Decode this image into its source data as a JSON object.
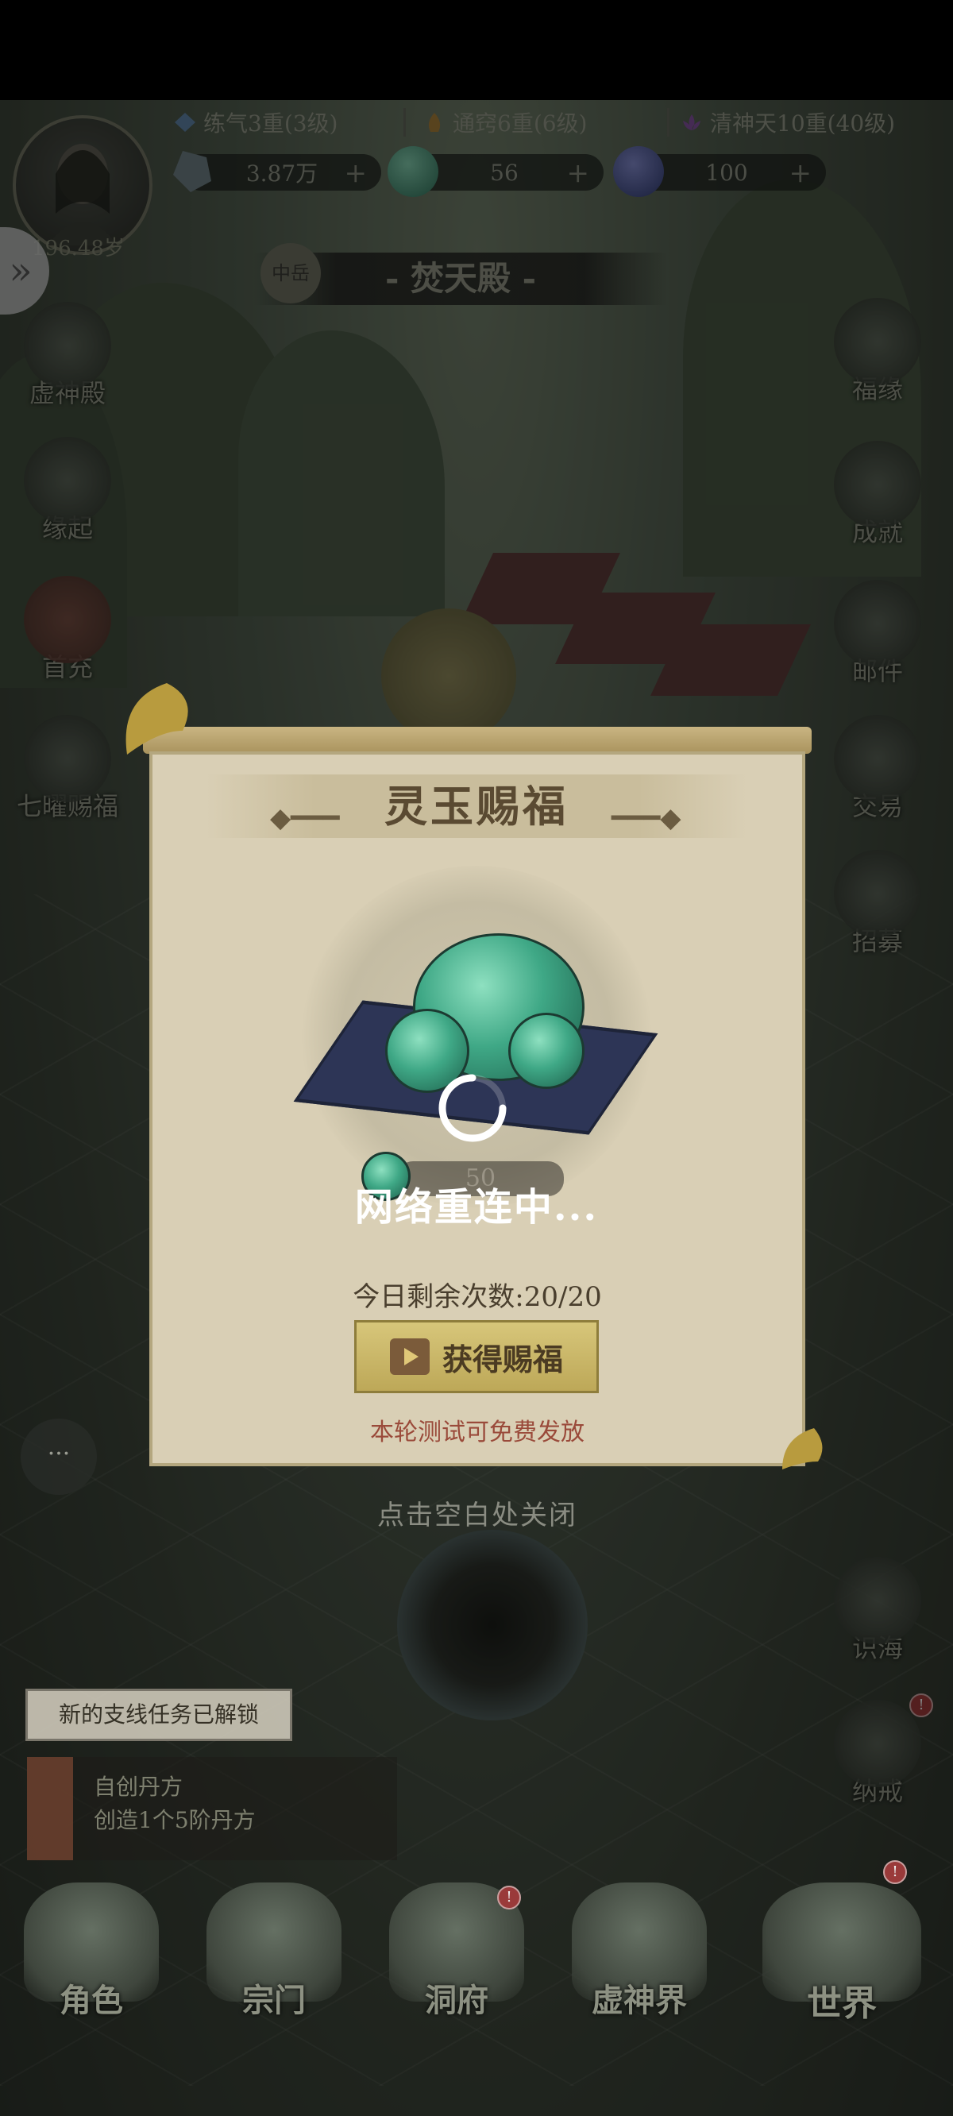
{
  "stats": [
    {
      "label": "练气3重(3级)",
      "color": "#6a8fb0"
    },
    {
      "label": "通窍6重(6级)",
      "color": "#b08a40"
    },
    {
      "label": "清神天10重(40级)",
      "color": "#9060b0"
    }
  ],
  "resources": [
    {
      "value": "3.87万",
      "plus": "+"
    },
    {
      "value": "56",
      "plus": "+"
    },
    {
      "value": "100",
      "plus": "+"
    }
  ],
  "player": {
    "age": "196.48岁"
  },
  "location": {
    "badge": "中岳",
    "name": "- 焚天殿 -"
  },
  "left_menu": [
    {
      "label": "虚神殿"
    },
    {
      "label": "缘起"
    },
    {
      "label": "首充"
    },
    {
      "label": "七曜赐福"
    }
  ],
  "right_menu": [
    {
      "label": "福缘"
    },
    {
      "label": "成就"
    },
    {
      "label": "邮件"
    },
    {
      "label": "交易"
    },
    {
      "label": "招募"
    },
    {
      "label": "识海"
    },
    {
      "label": "纳戒"
    }
  ],
  "modal": {
    "title": "灵玉赐福",
    "reward_count": "50",
    "remaining": "今日剩余次数:20/20",
    "claim_label": "获得赐福",
    "free_note": "本轮测试可免费发放",
    "close_hint": "点击空白处关闭"
  },
  "loading": {
    "text": "网络重连中..."
  },
  "chat": {
    "label": "···"
  },
  "quest": {
    "unlock_toast": "新的支线任务已解锁",
    "title": "自创丹方",
    "desc": "创造1个5阶丹方"
  },
  "bottom_nav": [
    {
      "label": "角色",
      "badge": false
    },
    {
      "label": "宗门",
      "badge": false
    },
    {
      "label": "洞府",
      "badge": true
    },
    {
      "label": "虚神界",
      "badge": false
    },
    {
      "label": "世界",
      "badge": true
    }
  ],
  "badge_mark": "!",
  "colors": {
    "accent": "#bda858",
    "panel": "#d9cfb5",
    "title": "#5a4a32",
    "warn": "#9a4a3a"
  }
}
